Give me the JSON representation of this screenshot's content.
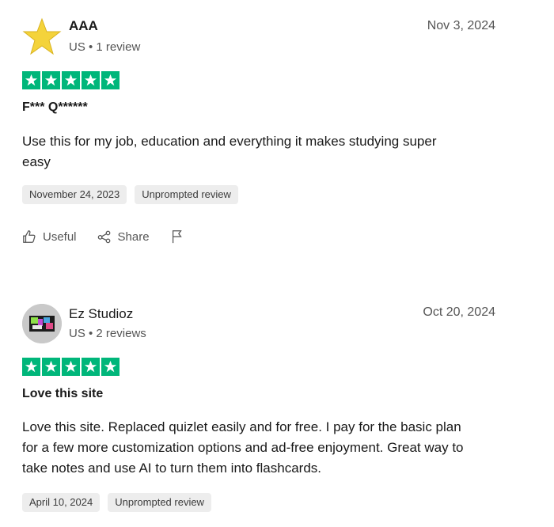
{
  "reviews": [
    {
      "name": "AAA",
      "meta": "US • 1 review",
      "date": "Nov 3, 2024",
      "rating": 5,
      "title": "F*** Q******",
      "body": "Use this for my job, education and everything it makes studying super easy",
      "tags": [
        "November 24, 2023",
        "Unprompted review"
      ],
      "avatar_icon": "star-icon"
    },
    {
      "name": "Ez Studioz",
      "meta": "US • 2 reviews",
      "date": "Oct 20, 2024",
      "rating": 5,
      "title": "Love this site",
      "body": "Love this site. Replaced quizlet easily and for free. I pay for the basic plan for a few more customization options and ad-free enjoyment. Great way to take notes and use AI to turn them into flashcards.",
      "tags": [
        "April 10, 2024",
        "Unprompted review"
      ],
      "avatar_icon": "avatar-image"
    }
  ],
  "actions": {
    "useful_label": "Useful",
    "share_label": "Share"
  },
  "colors": {
    "star_green": "#00b67a",
    "tag_bg": "#ededed"
  }
}
